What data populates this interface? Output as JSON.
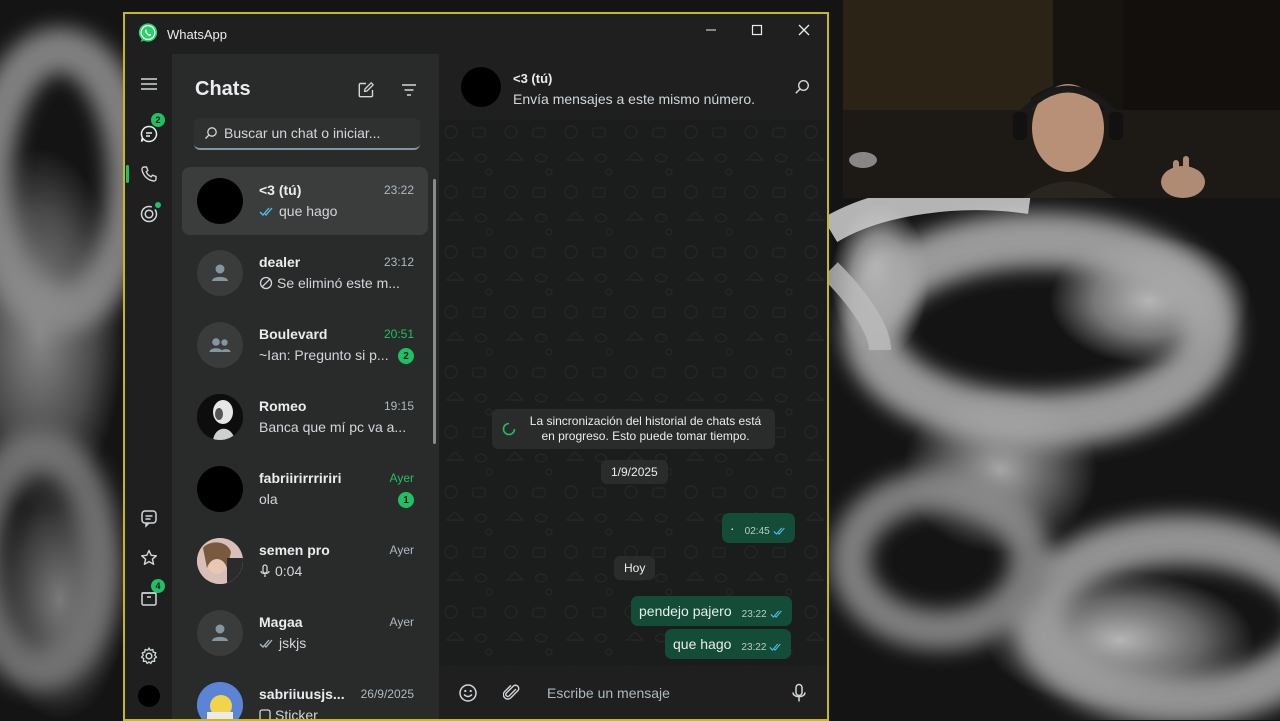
{
  "window": {
    "title": "WhatsApp"
  },
  "rail": {
    "chats_badge": "2",
    "archive_badge": "4"
  },
  "chatlist": {
    "title": "Chats",
    "search_placeholder": "Buscar un chat o iniciar...",
    "items": [
      {
        "name": "<3 (tú)",
        "time": "23:22",
        "preview": "que hago",
        "ticks": "read",
        "avatar": "black",
        "selected": true
      },
      {
        "name": "dealer",
        "time": "23:12",
        "preview": "Se eliminó este m...",
        "icon": "deleted-icon",
        "avatar": "default-person"
      },
      {
        "name": "Boulevard",
        "time": "20:51",
        "preview": "~Ian: Pregunto si p...",
        "unread": "2",
        "time_color": "#21c063",
        "avatar": "default-group"
      },
      {
        "name": "Romeo",
        "time": "19:15",
        "preview": "Banca que mí pc va a...",
        "avatar": "photo-bw"
      },
      {
        "name": "fabriirirrririri",
        "time": "Ayer",
        "preview": "ola",
        "unread": "1",
        "time_color": "#21c063",
        "avatar": "black"
      },
      {
        "name": "semen pro",
        "time": "Ayer",
        "preview": "0:04",
        "icon": "mic-icon",
        "avatar": "photo-pink"
      },
      {
        "name": "Magaa",
        "time": "Ayer",
        "preview": "jskjs",
        "ticks": "sent",
        "avatar": "default-person"
      },
      {
        "name": "sabriiuusjs...",
        "time": "26/9/2025",
        "preview": "Sticker",
        "icon": "sticker-icon",
        "avatar": "photo-blue"
      }
    ]
  },
  "conversation": {
    "name": "<3 (tú)",
    "subtitle": "Envía mensajes a este mismo número.",
    "system_message": "La sincronización del historial de chats está en progreso. Esto puede tomar tiempo.",
    "date_1": "1/9/2025",
    "msg_dot": {
      "text": "·",
      "time": "02:45"
    },
    "date_2": "Hoy",
    "msg_1": {
      "text": "pendejo pajero",
      "time": "23:22"
    },
    "msg_2": {
      "text": "que hago",
      "time": "23:22"
    },
    "composer_placeholder": "Escribe un mensaje"
  },
  "colors": {
    "accent": "#21c063",
    "bubble_out": "#144d37",
    "window_border": "#c7b52a"
  }
}
